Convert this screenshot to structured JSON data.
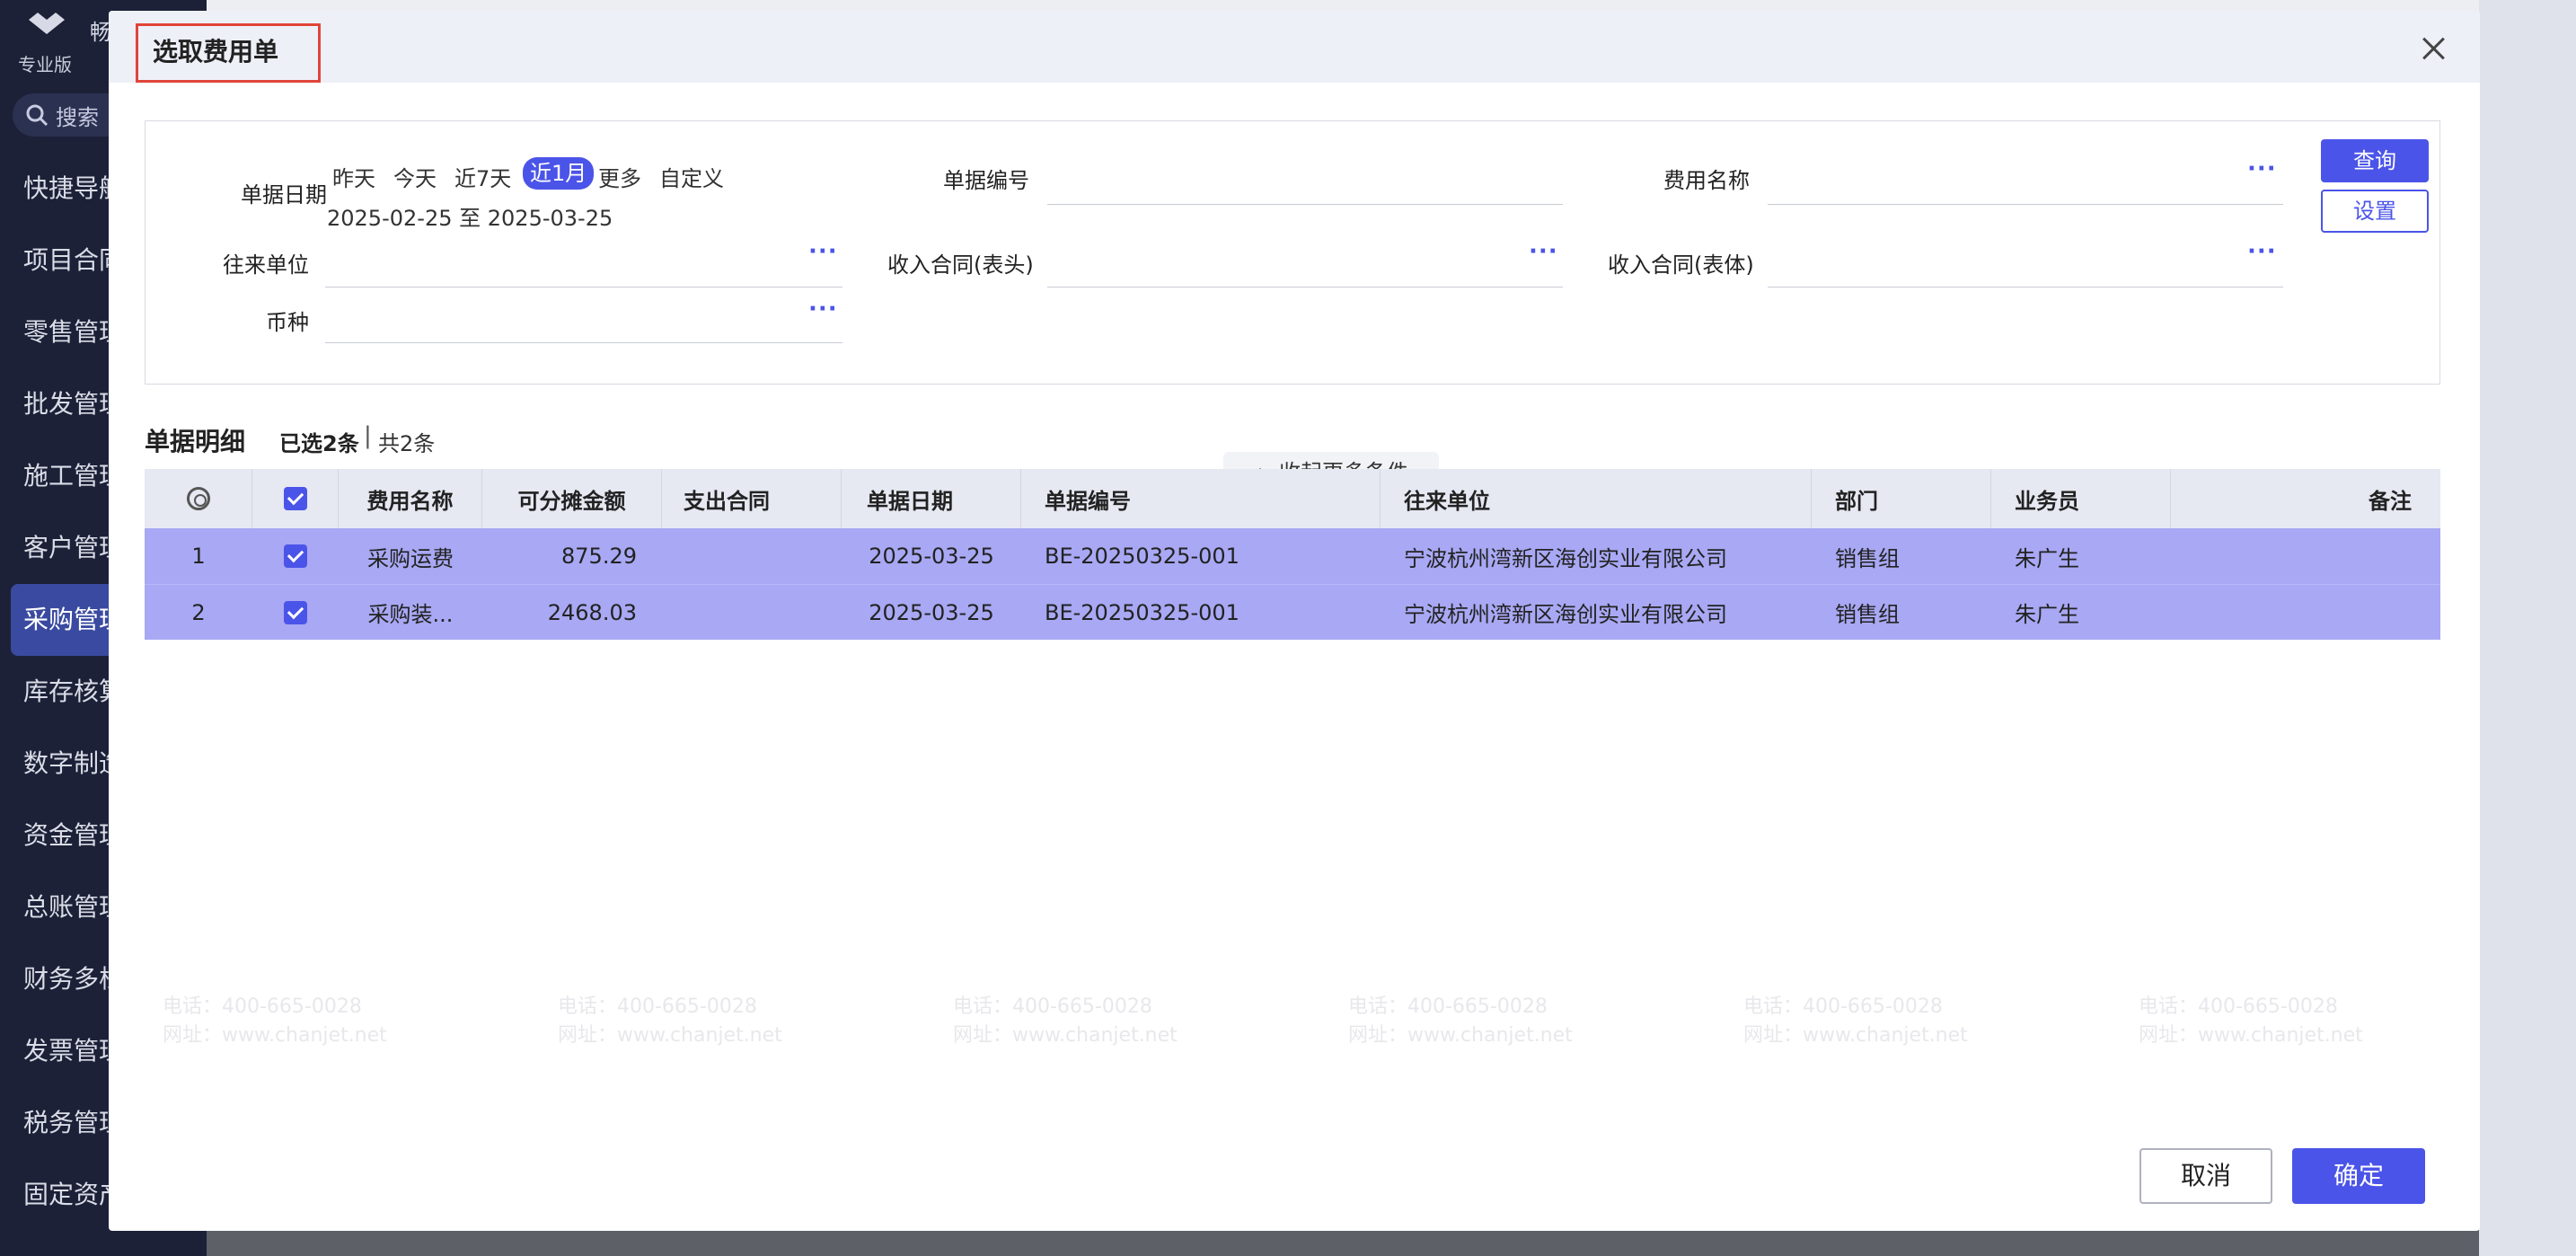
{
  "app": {
    "logo_name": "畅捷",
    "edition": "专业版",
    "search_placeholder": "搜索"
  },
  "sidebar": {
    "items": [
      {
        "label": "快捷导航"
      },
      {
        "label": "项目合同"
      },
      {
        "label": "零售管理"
      },
      {
        "label": "批发管理"
      },
      {
        "label": "施工管理"
      },
      {
        "label": "客户管理"
      },
      {
        "label": "采购管理"
      },
      {
        "label": "库存核算"
      },
      {
        "label": "数字制造"
      },
      {
        "label": "资金管理"
      },
      {
        "label": "总账管理"
      },
      {
        "label": "财务多栏"
      },
      {
        "label": "发票管理"
      },
      {
        "label": "税务管理"
      },
      {
        "label": "固定资产"
      }
    ]
  },
  "modal": {
    "title": "选取费用单",
    "filters": {
      "date_label": "单据日期",
      "quick_dates": [
        "昨天",
        "今天",
        "近7天",
        "近1月",
        "更多",
        "自定义"
      ],
      "selected_quick": "近1月",
      "date_from": "2025-02-25",
      "date_sep": "至",
      "date_to": "2025-03-25",
      "doc_no_label": "单据编号",
      "fee_name_label": "费用名称",
      "partner_label": "往来单位",
      "income_contract_head_label": "收入合同(表头)",
      "income_contract_body_label": "收入合同(表体)",
      "currency_label": "币种",
      "dots": "···",
      "query_label": "查询",
      "settings_label": "设置",
      "collapse_label": "收起更多条件"
    },
    "detail": {
      "title": "单据明细",
      "selected_text": "已选2条",
      "sep": "|",
      "total_text": "共2条"
    },
    "columns": [
      "费用名称",
      "可分摊金额",
      "支出合同",
      "单据日期",
      "单据编号",
      "往来单位",
      "部门",
      "业务员",
      "备注"
    ],
    "rows": [
      {
        "no": "1",
        "fee_name": "采购运费",
        "amount": "875.29",
        "contract": "",
        "date": "2025-03-25",
        "doc_no": "BE-20250325-001",
        "partner": "宁波杭州湾新区海创实业有限公司",
        "dept": "销售组",
        "staff": "朱广生",
        "remark": ""
      },
      {
        "no": "2",
        "fee_name": "采购装...",
        "amount": "2468.03",
        "contract": "",
        "date": "2025-03-25",
        "doc_no": "BE-20250325-001",
        "partner": "宁波杭州湾新区海创实业有限公司",
        "dept": "销售组",
        "staff": "朱广生",
        "remark": ""
      }
    ],
    "cancel_label": "取消",
    "ok_label": "确定"
  },
  "watermark": {
    "phone": "电话：400-665-0028",
    "site": "网址：www.chanjet.net"
  },
  "colors": {
    "accent": "#4b54e8",
    "selected_row": "#a8a8f4",
    "title_highlight": "#e0453a"
  }
}
